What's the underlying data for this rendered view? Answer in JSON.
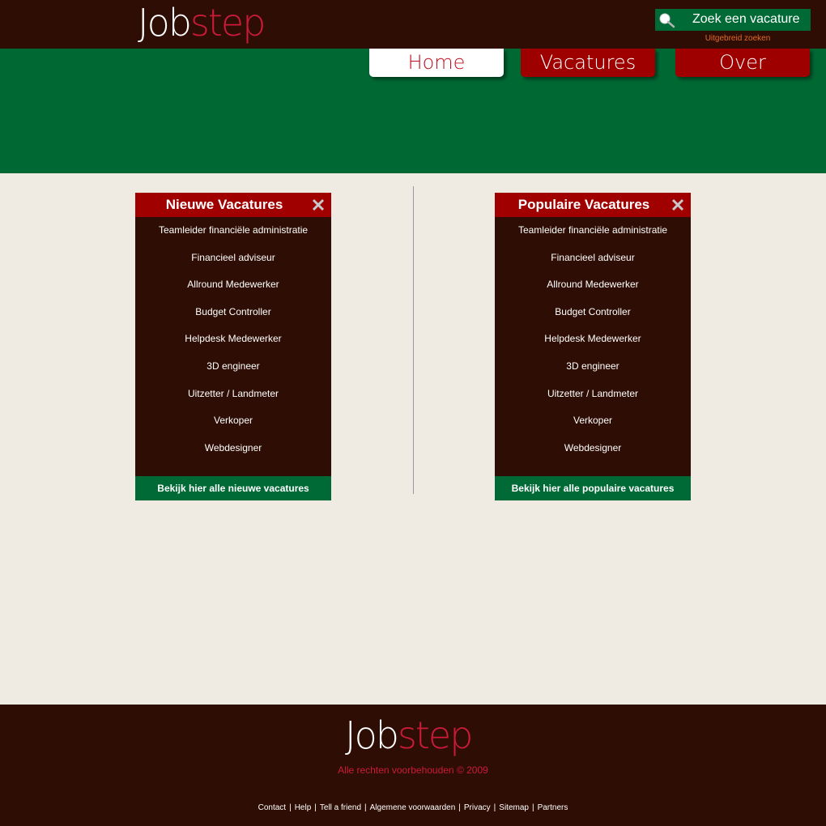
{
  "header": {
    "logo_part1": "Job",
    "logo_part2": "step",
    "search_label": "Zoek een vacature",
    "advanced_search": "Uitgebreid zoeken"
  },
  "nav": {
    "tabs": [
      {
        "label": "Home",
        "active": true
      },
      {
        "label": "Vacatures",
        "active": false
      },
      {
        "label": "Over",
        "active": false
      }
    ]
  },
  "panels": {
    "new": {
      "title": "Nieuwe Vacatures",
      "items": [
        "Teamleider financiële administratie",
        "Financieel adviseur",
        "Allround Medewerker",
        "Budget Controller",
        "Helpdesk Medewerker",
        "3D engineer",
        "Uitzetter / Landmeter",
        "Verkoper",
        "Webdesigner"
      ],
      "footer_link": "Bekijk hier alle nieuwe vacatures"
    },
    "popular": {
      "title": "Populaire Vacatures",
      "items": [
        "Teamleider financiële administratie",
        "Financieel adviseur",
        "Allround Medewerker",
        "Budget Controller",
        "Helpdesk Medewerker",
        "3D engineer",
        "Uitzetter / Landmeter",
        "Verkoper",
        "Webdesigner"
      ],
      "footer_link": "Bekijk hier alle populaire vacatures"
    }
  },
  "footer": {
    "logo_part1": "Job",
    "logo_part2": "step",
    "copyright": "Alle rechten voorbehouden © 2009",
    "links": [
      "Contact",
      "Help",
      "Tell a friend",
      "Algemene voorwaarden",
      "Privacy",
      "Sitemap",
      "Partners"
    ]
  },
  "colors": {
    "dark_brown": "#2e0e04",
    "green": "#006833",
    "red": "#a00000",
    "logo_red": "#cc1a3a",
    "background": "#efebe3"
  }
}
